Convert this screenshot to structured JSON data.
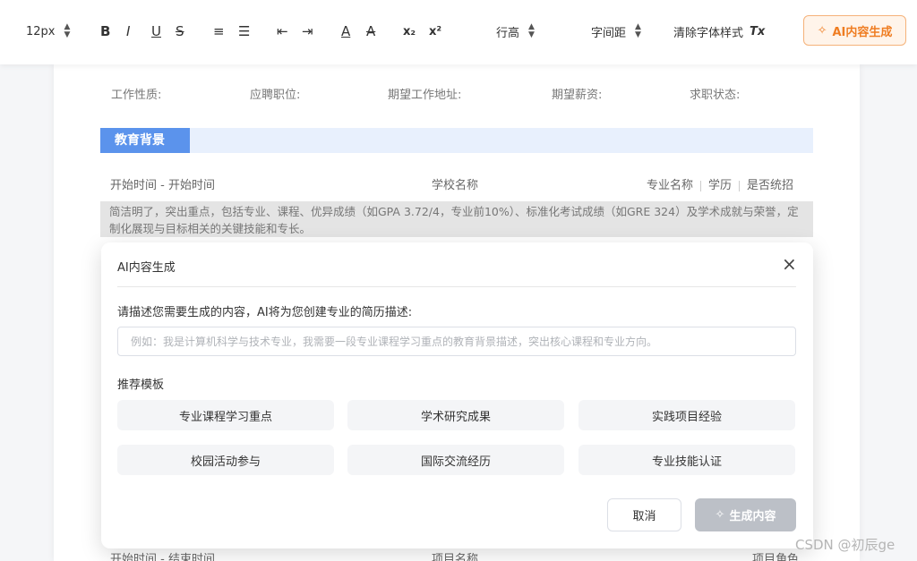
{
  "toolbar": {
    "font_size": "12px",
    "bold": "B",
    "italic": "I",
    "underline": "U",
    "strike": "S",
    "ordered_list": "≡",
    "unordered_list": "☰",
    "outdent": "⇤",
    "indent": "⇥",
    "font_color": "A",
    "highlight": "A",
    "subscript": "x₂",
    "superscript": "x²",
    "line_height": "行高",
    "letter_spacing": "字间距",
    "clear_format": "清除字体样式",
    "clear_format_icon": "Tx",
    "ai_button": "AI内容生成",
    "ai_icon": "✧"
  },
  "resume": {
    "meta": [
      "工作性质:",
      "应聘职位:",
      "期望工作地址:",
      "期望薪资:",
      "求职状态:"
    ],
    "section_title": "教育背景",
    "edu": {
      "time": "开始时间 - 开始时间",
      "school": "学校名称",
      "major": "专业名称",
      "degree": "学历",
      "unified": "是否统招"
    },
    "description": "简洁明了，突出重点，包括专业、课程、优异成绩（如GPA 3.72/4，专业前10%）、标准化考试成绩（如GRE 324）及学术成就与荣誉，定制化展现与目标相关的关键技能和专长。",
    "next_row": {
      "time": "开始时间 - 结束时间",
      "project": "项目名称",
      "role": "项目角色"
    }
  },
  "modal": {
    "title": "AI内容生成",
    "close": "×",
    "prompt": "请描述您需要生成的内容，AI将为您创建专业的简历描述:",
    "input_placeholder": "例如：我是计算机科学与技术专业，我需要一段专业课程学习重点的教育背景描述，突出核心课程和专业方向。",
    "templates_label": "推荐模板",
    "templates": [
      "专业课程学习重点",
      "学术研究成果",
      "实践项目经验",
      "校园活动参与",
      "国际交流经历",
      "专业技能认证"
    ],
    "cancel": "取消",
    "generate": "生成内容",
    "generate_icon": "✧"
  },
  "watermark": "CSDN @初辰ge",
  "colors": {
    "accent_orange": "#ef7d22",
    "section_blue": "#5b93ec",
    "disabled_button": "#bcc0c7"
  }
}
